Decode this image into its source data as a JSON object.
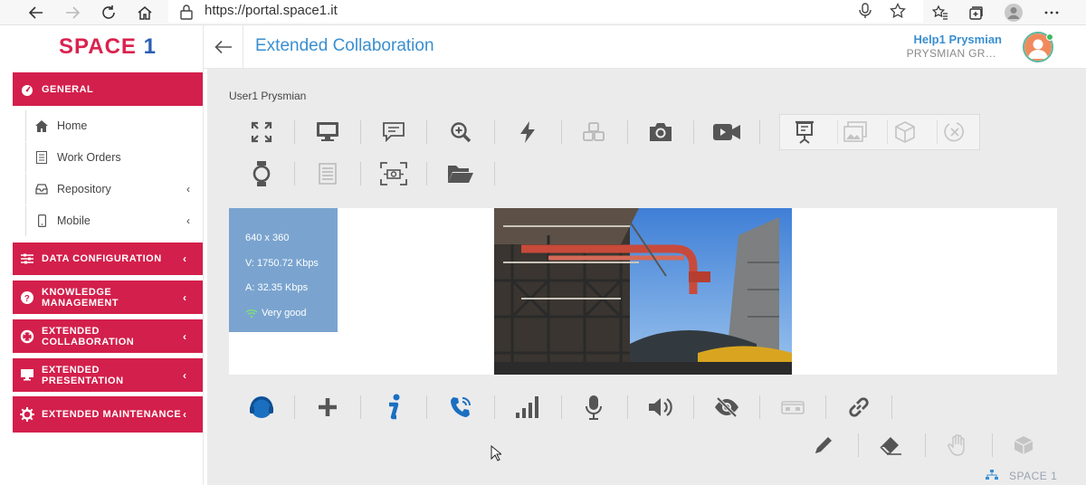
{
  "browser": {
    "url": "https://portal.space1.it",
    "icons": [
      "back-arrow-icon",
      "forward-arrow-icon",
      "reload-icon",
      "home-icon",
      "lock-icon",
      "microphone-icon",
      "star-icon",
      "favorites-icon",
      "collections-icon",
      "profile-icon",
      "more-icon"
    ]
  },
  "app": {
    "logo_left": "SPACE",
    "logo_right": "1",
    "title": "Extended Collaboration",
    "user_name": "Help1 Prysmian",
    "user_org": "PRYSMIAN GR…",
    "accent": "#d31f4b",
    "title_color": "#3a8fd1"
  },
  "sidebar": {
    "sections": [
      {
        "label": "GENERAL",
        "icon": "dashboard-icon"
      },
      {
        "label": "DATA CONFIGURATION",
        "icon": "sliders-icon"
      },
      {
        "label": "KNOWLEDGE MANAGEMENT",
        "icon": "question-icon"
      },
      {
        "label": "EXTENDED COLLABORATION",
        "icon": "lifebuoy-icon"
      },
      {
        "label": "EXTENDED PRESENTATION",
        "icon": "monitor-icon"
      },
      {
        "label": "EXTENDED MAINTENANCE",
        "icon": "gear-icon"
      }
    ],
    "general_items": [
      {
        "label": "Home",
        "icon": "home-icon"
      },
      {
        "label": "Work Orders",
        "icon": "list-icon"
      },
      {
        "label": "Repository",
        "icon": "inbox-icon"
      },
      {
        "label": "Mobile",
        "icon": "mobile-icon"
      }
    ]
  },
  "session": {
    "user": "User1 Prysmian",
    "stats": {
      "resolution": "640 x 360",
      "video": "V: 1750.72 Kbps",
      "audio": "A: 32.35 Kbps",
      "quality": "Very good"
    }
  },
  "footer": {
    "brand": "SPACE 1"
  }
}
